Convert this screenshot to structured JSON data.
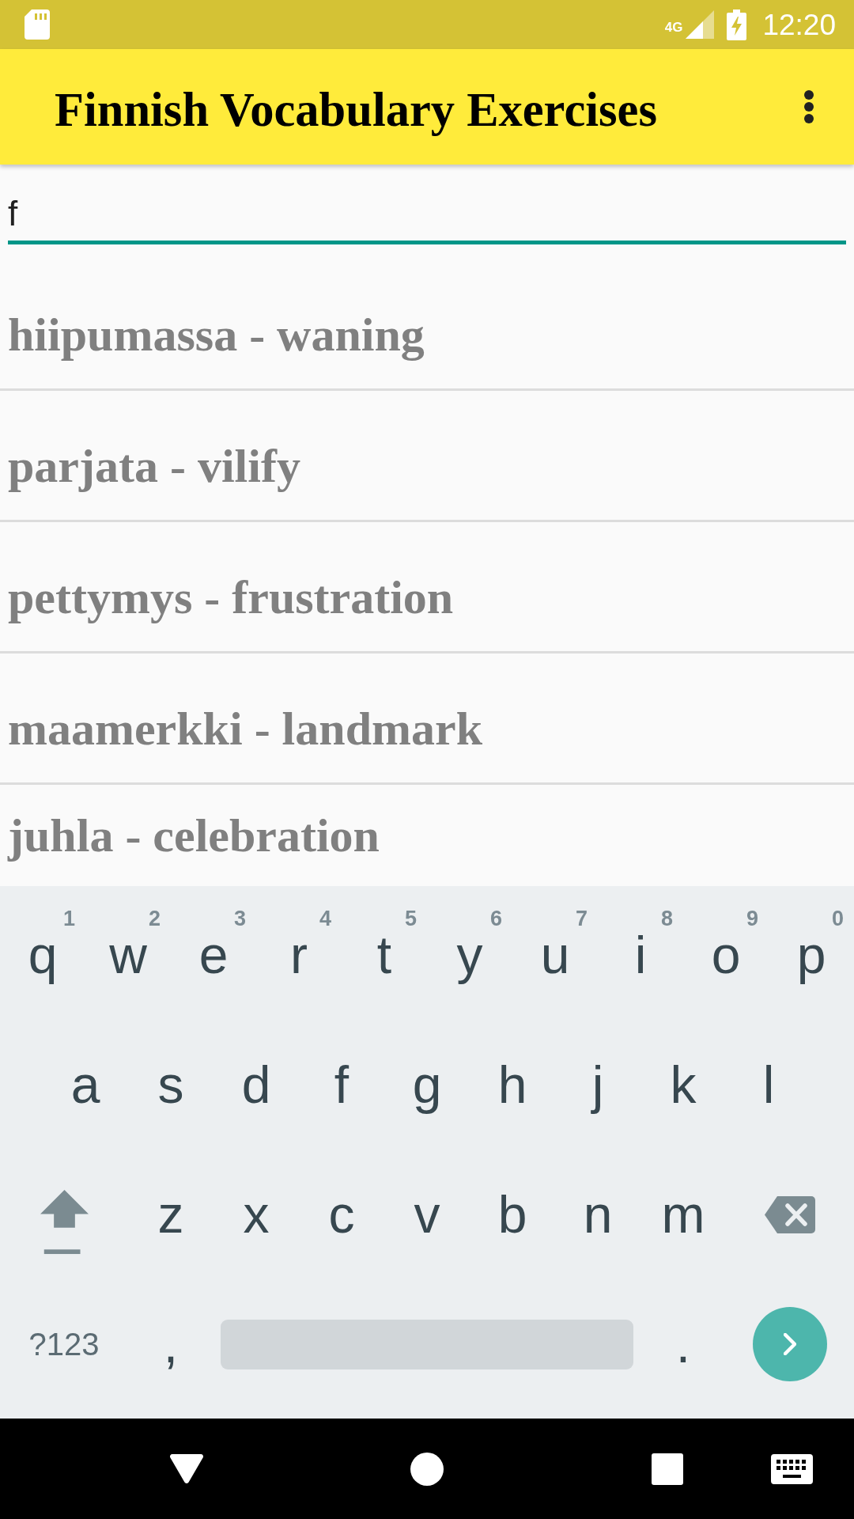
{
  "status_bar": {
    "network": "4G",
    "time": "12:20"
  },
  "app_bar": {
    "title": "Finnish Vocabulary Exercises"
  },
  "search": {
    "value": "f"
  },
  "words": [
    "hiipumassa - waning",
    "parjata - vilify",
    "pettymys - frustration",
    "maamerkki - landmark",
    "juhla - celebration"
  ],
  "keyboard": {
    "rows": [
      {
        "keys": [
          {
            "kind": "letter",
            "label": "q",
            "hint": "1"
          },
          {
            "kind": "letter",
            "label": "w",
            "hint": "2"
          },
          {
            "kind": "letter",
            "label": "e",
            "hint": "3"
          },
          {
            "kind": "letter",
            "label": "r",
            "hint": "4"
          },
          {
            "kind": "letter",
            "label": "t",
            "hint": "5"
          },
          {
            "kind": "letter",
            "label": "y",
            "hint": "6"
          },
          {
            "kind": "letter",
            "label": "u",
            "hint": "7"
          },
          {
            "kind": "letter",
            "label": "i",
            "hint": "8"
          },
          {
            "kind": "letter",
            "label": "o",
            "hint": "9"
          },
          {
            "kind": "letter",
            "label": "p",
            "hint": "0"
          }
        ]
      },
      {
        "keys": [
          {
            "kind": "letter",
            "label": "a"
          },
          {
            "kind": "letter",
            "label": "s"
          },
          {
            "kind": "letter",
            "label": "d"
          },
          {
            "kind": "letter",
            "label": "f"
          },
          {
            "kind": "letter",
            "label": "g"
          },
          {
            "kind": "letter",
            "label": "h"
          },
          {
            "kind": "letter",
            "label": "j"
          },
          {
            "kind": "letter",
            "label": "k"
          },
          {
            "kind": "letter",
            "label": "l"
          }
        ]
      },
      {
        "keys": [
          {
            "kind": "shift"
          },
          {
            "kind": "letter",
            "label": "z"
          },
          {
            "kind": "letter",
            "label": "x"
          },
          {
            "kind": "letter",
            "label": "c"
          },
          {
            "kind": "letter",
            "label": "v"
          },
          {
            "kind": "letter",
            "label": "b"
          },
          {
            "kind": "letter",
            "label": "n"
          },
          {
            "kind": "letter",
            "label": "m"
          },
          {
            "kind": "backspace"
          }
        ]
      },
      {
        "keys": [
          {
            "kind": "mode",
            "label": "?123"
          },
          {
            "kind": "letter",
            "label": ","
          },
          {
            "kind": "space"
          },
          {
            "kind": "letter",
            "label": "."
          },
          {
            "kind": "enter"
          }
        ]
      }
    ]
  }
}
